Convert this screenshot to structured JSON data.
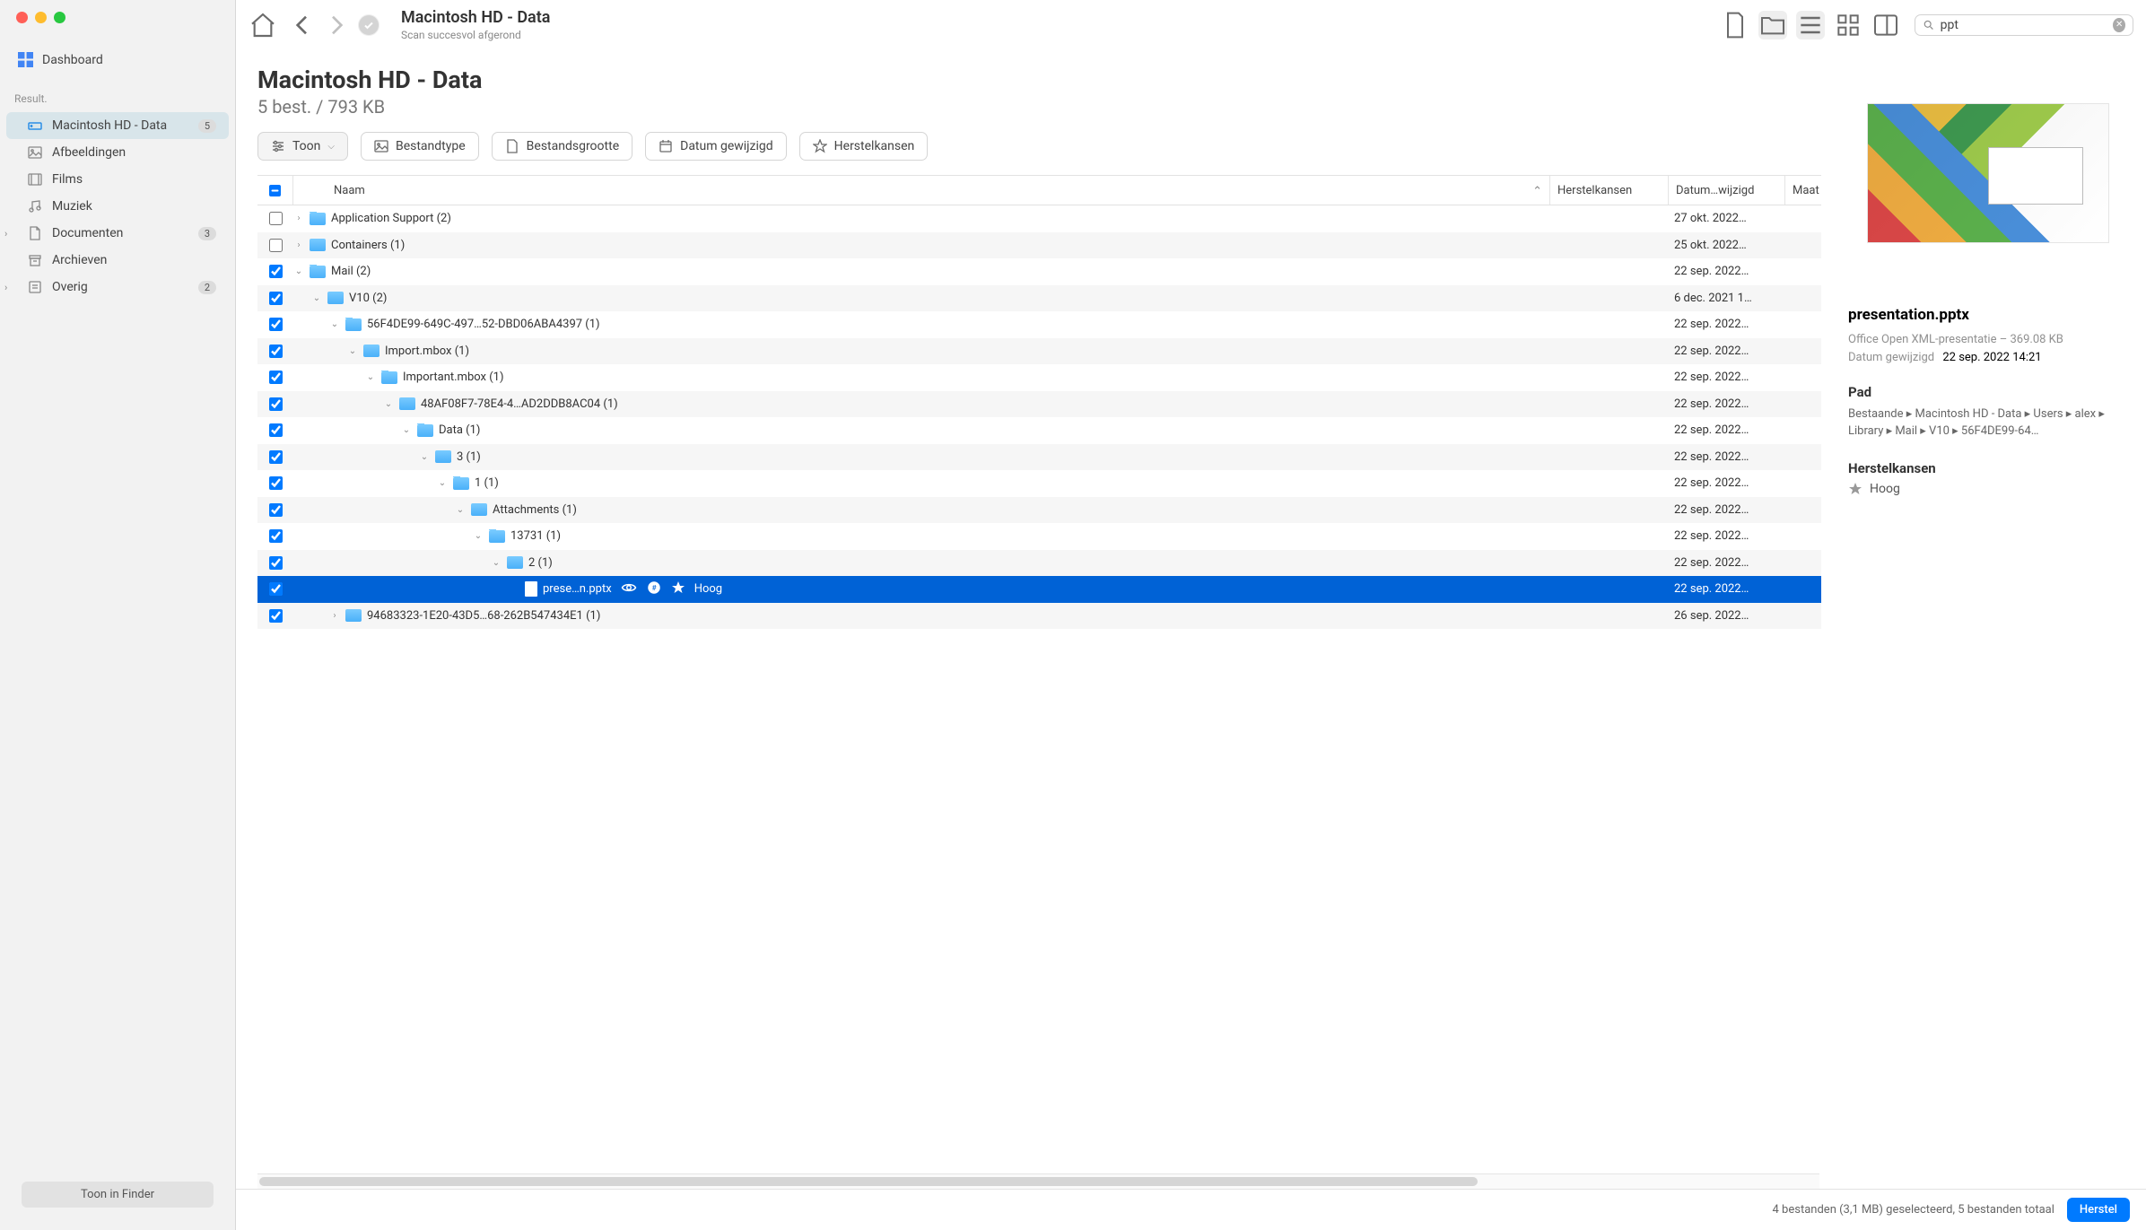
{
  "window": {
    "title": "Macintosh HD - Data",
    "subtitle": "Scan succesvol afgerond"
  },
  "search": {
    "value": "ppt"
  },
  "sidebar": {
    "dashboard": "Dashboard",
    "result_label": "Result.",
    "items": [
      {
        "id": "drive",
        "label": "Macintosh HD - Data",
        "badge": "5",
        "selected": true,
        "expandable": false,
        "icon": "drive"
      },
      {
        "id": "images",
        "label": "Afbeeldingen",
        "icon": "image"
      },
      {
        "id": "films",
        "label": "Films",
        "icon": "film"
      },
      {
        "id": "music",
        "label": "Muziek",
        "icon": "music"
      },
      {
        "id": "docs",
        "label": "Documenten",
        "badge": "3",
        "expandable": true,
        "icon": "doc"
      },
      {
        "id": "archives",
        "label": "Archieven",
        "icon": "archive"
      },
      {
        "id": "other",
        "label": "Overig",
        "badge": "2",
        "expandable": true,
        "icon": "other"
      }
    ],
    "footer_button": "Toon in Finder"
  },
  "page_header": {
    "title": "Macintosh HD - Data",
    "summary": "5 best. / 793 KB"
  },
  "filters": {
    "toon": "Toon",
    "filetype": "Bestandtype",
    "filesize": "Bestandsgrootte",
    "date": "Datum gewijzigd",
    "recovery": "Herstelkansen"
  },
  "columns": {
    "name": "Naam",
    "recovery": "Herstelkansen",
    "date": "Datum…wijzigd",
    "size": "Maat"
  },
  "rows": [
    {
      "checked": false,
      "indeterminate": false,
      "depth": 0,
      "name": "Application Support (2)",
      "disclosure": "right",
      "type": "folder",
      "date": "27 okt. 2022…"
    },
    {
      "checked": false,
      "indeterminate": false,
      "depth": 0,
      "name": "Containers (1)",
      "disclosure": "right",
      "type": "folder",
      "date": "25 okt. 2022…"
    },
    {
      "checked": true,
      "depth": 0,
      "name": "Mail (2)",
      "disclosure": "down",
      "type": "folder",
      "date": "22 sep. 2022…"
    },
    {
      "checked": true,
      "depth": 1,
      "name": "V10 (2)",
      "disclosure": "down",
      "type": "folder",
      "date": "6 dec. 2021 1…"
    },
    {
      "checked": true,
      "depth": 2,
      "name": "56F4DE99-649C-497…52-DBD06ABA4397 (1)",
      "disclosure": "down",
      "type": "folder",
      "date": "22 sep. 2022…"
    },
    {
      "checked": true,
      "depth": 3,
      "name": "Import.mbox (1)",
      "disclosure": "down",
      "type": "folder",
      "date": "22 sep. 2022…"
    },
    {
      "checked": true,
      "depth": 4,
      "name": "Important.mbox (1)",
      "disclosure": "down",
      "type": "folder",
      "date": "22 sep. 2022…"
    },
    {
      "checked": true,
      "depth": 5,
      "name": "48AF08F7-78E4-4…AD2DDB8AC04 (1)",
      "disclosure": "down",
      "type": "folder",
      "date": "22 sep. 2022…"
    },
    {
      "checked": true,
      "depth": 6,
      "name": "Data (1)",
      "disclosure": "down",
      "type": "folder",
      "date": "22 sep. 2022…"
    },
    {
      "checked": true,
      "depth": 7,
      "name": "3 (1)",
      "disclosure": "down",
      "type": "folder",
      "date": "22 sep. 2022…"
    },
    {
      "checked": true,
      "depth": 8,
      "name": "1 (1)",
      "disclosure": "down",
      "type": "folder",
      "date": "22 sep. 2022…"
    },
    {
      "checked": true,
      "depth": 9,
      "name": "Attachments (1)",
      "disclosure": "down",
      "type": "folder",
      "date": "22 sep. 2022…"
    },
    {
      "checked": true,
      "depth": 10,
      "name": "13731 (1)",
      "disclosure": "down",
      "type": "folder",
      "date": "22 sep. 2022…"
    },
    {
      "checked": true,
      "depth": 11,
      "name": "2 (1)",
      "disclosure": "down",
      "type": "folder",
      "date": "22 sep. 2022…"
    },
    {
      "checked": true,
      "depth": 12,
      "name": "prese…n.pptx",
      "type": "file",
      "date": "22 sep. 2022…",
      "selected": true,
      "hoog": "Hoog"
    },
    {
      "checked": true,
      "depth": 2,
      "name": "94683323-1E20-43D5…68-262B547434E1 (1)",
      "disclosure": "right",
      "type": "folder",
      "date": "26 sep. 2022…"
    }
  ],
  "checkbox_states": {
    "header_indeterminate": true
  },
  "detail": {
    "filename": "presentation.pptx",
    "type_size": "Office Open XML-presentatie – 369.08 KB",
    "date_label": "Datum gewijzigd",
    "date_value": "22 sep. 2022 14:21",
    "path_heading": "Pad",
    "path_text": "Bestaande ▸ Macintosh HD - Data ▸ Users ▸ alex ▸ Library ▸ Mail ▸ V10 ▸ 56F4DE99-64…",
    "recovery_heading": "Herstelkansen",
    "recovery_value": "Hoog"
  },
  "statusbar": {
    "text": "4 bestanden (3,1 MB) geselecteerd, 5 bestanden totaal",
    "action": "Herstel"
  }
}
